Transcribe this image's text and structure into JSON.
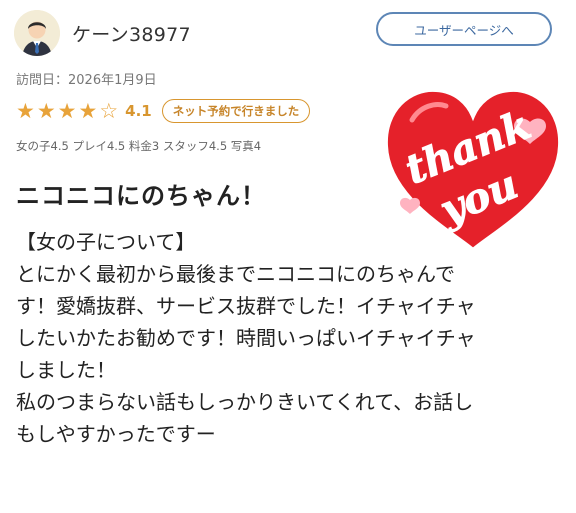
{
  "user": {
    "name": "ケーン38977",
    "page_button": "ユーザーページへ"
  },
  "visit": {
    "date": "訪問日：2026年1月9日"
  },
  "rating": {
    "value": "4.1",
    "stars_full": 4,
    "stars_total": 5,
    "badge": "ネット予約で行きました",
    "sub_scores": "女の子4.5 プレイ4.5 料金3 スタッフ4.5 写真4",
    "color": "#e8a33a"
  },
  "review": {
    "title": "ニコニコにのちゃん！",
    "lines": [
      "【女の子について】",
      "とにかく最初から最後までニコニコにのちゃんで",
      "す！愛嬌抜群、サービス抜群でした！イチャイチャ",
      "したいかたお勧めです！時間いっぱいイチャイチャ",
      "しました！",
      "私のつまらない話もしっかりきいてくれて、お話し",
      "もしやすかったですー"
    ]
  },
  "sticker": {
    "line1": "thank",
    "line2": "you",
    "color": "#e5212a"
  }
}
